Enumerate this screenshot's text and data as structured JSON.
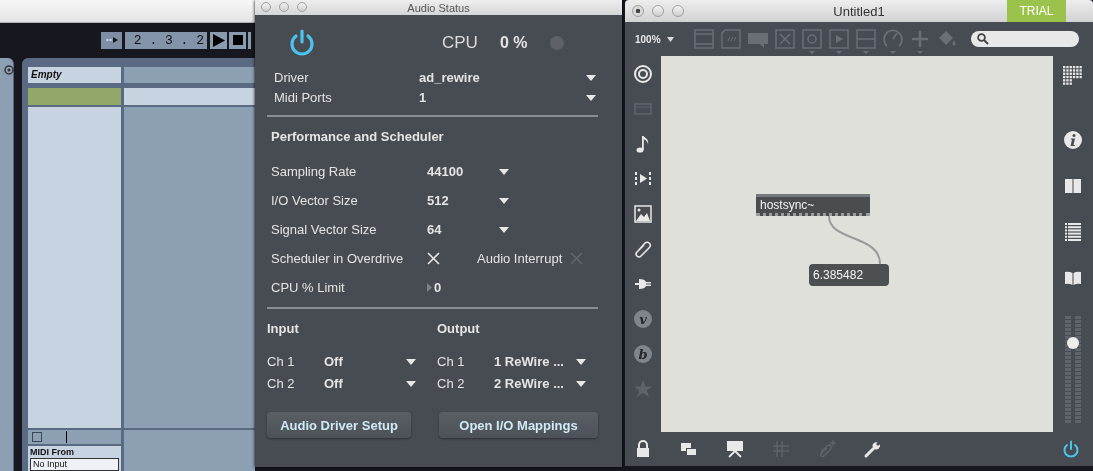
{
  "daw": {
    "transport": {
      "position": "2 . 3 . 2"
    },
    "clip_slot": {
      "title": "Empty"
    },
    "monitor_checkbox": {
      "checked": false
    },
    "midi_from": {
      "label": "MIDI From",
      "value": "No Input"
    }
  },
  "audio_status": {
    "title": "Audio Status",
    "power_on": true,
    "cpu": {
      "label": "CPU",
      "value": "0 %"
    },
    "device": [
      {
        "label": "Driver",
        "value": "ad_rewire"
      },
      {
        "label": "Midi Ports",
        "value": "1"
      }
    ],
    "section_title": "Performance and Scheduler",
    "performance": [
      {
        "kind": "dropdown",
        "label": "Sampling Rate",
        "value": "44100"
      },
      {
        "kind": "dropdown",
        "label": "I/O Vector Size",
        "value": "512"
      },
      {
        "kind": "dropdown",
        "label": "Signal Vector Size",
        "value": "64"
      },
      {
        "kind": "toggles",
        "toggles": [
          {
            "label": "Scheduler in Overdrive",
            "checked": true
          },
          {
            "label": "Audio Interrupt",
            "checked": false
          }
        ]
      },
      {
        "kind": "number",
        "label": "CPU % Limit",
        "value": "0"
      }
    ],
    "input": {
      "title": "Input",
      "channels": [
        {
          "label": "Ch 1",
          "value": "Off"
        },
        {
          "label": "Ch 2",
          "value": "Off"
        }
      ]
    },
    "output": {
      "title": "Output",
      "channels": [
        {
          "label": "Ch 1",
          "value": "1 ReWire ..."
        },
        {
          "label": "Ch 2",
          "value": "2 ReWire ..."
        }
      ]
    },
    "buttons": [
      "Audio Driver Setup",
      "Open I/O Mappings"
    ]
  },
  "patcher": {
    "title": "Untitled1",
    "badge": "TRIAL",
    "zoom": "100%",
    "left_tools": [
      {
        "kind": "target",
        "disabled": false
      },
      {
        "kind": "film",
        "disabled": true
      },
      {
        "kind": "note",
        "disabled": false
      },
      {
        "kind": "play",
        "disabled": false
      },
      {
        "kind": "image",
        "disabled": false
      },
      {
        "kind": "clip",
        "disabled": false
      },
      {
        "kind": "plug",
        "disabled": false
      },
      {
        "kind": "letter",
        "glyph": "v",
        "disabled": true
      },
      {
        "kind": "letter",
        "glyph": "b",
        "disabled": true
      },
      {
        "kind": "star",
        "disabled": true
      }
    ],
    "objects": [
      {
        "kind": "object",
        "text": "hostsync~"
      },
      {
        "kind": "number",
        "text": "6.385482"
      }
    ],
    "right_tools": [
      {
        "kind": "grid"
      },
      {
        "kind": "info"
      },
      {
        "kind": "book"
      },
      {
        "kind": "list"
      },
      {
        "kind": "open-book"
      }
    ],
    "volume": {
      "level": 0.75
    },
    "bottom_tools": [
      {
        "kind": "lock",
        "disabled": false
      },
      {
        "kind": "windows",
        "disabled": false
      },
      {
        "kind": "presentation",
        "disabled": false
      },
      {
        "kind": "grid",
        "disabled": true
      },
      {
        "kind": "clip-plus",
        "disabled": true
      },
      {
        "kind": "wrench",
        "disabled": false
      }
    ],
    "dsp_on": true
  }
}
